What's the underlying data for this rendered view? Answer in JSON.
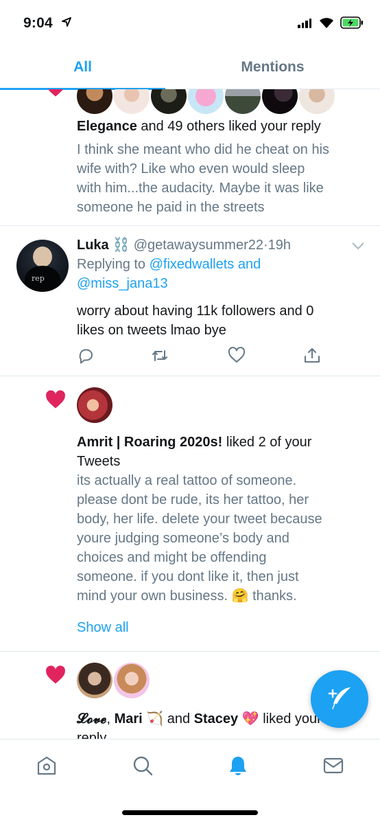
{
  "status": {
    "time": "9:04"
  },
  "tabs": [
    {
      "label": "All",
      "active": true
    },
    {
      "label": "Mentions",
      "active": false
    }
  ],
  "item1": {
    "liker": "Elegance",
    "rest": " and 49 others liked your reply",
    "text_lines": [
      "I think she meant who did he cheat on his",
      "wife with? Like who even would sleep",
      "with him...the audacity. Maybe it was like",
      "someone he paid in the streets"
    ]
  },
  "tweet": {
    "name": "Luka",
    "name_emoji": "⛓️",
    "handle": "@getawaysummer22",
    "time": "19h",
    "reply_prefix": "Replying to ",
    "reply_to_1": "@fixedwallets and",
    "reply_to_2": "@miss_jana13",
    "body_lines": [
      "worry about having 11k followers and 0",
      "likes on tweets lmao bye"
    ]
  },
  "item3": {
    "liker": "Amrit | Roaring 2020s!",
    "rest": " liked 2 of your",
    "rest2": "Tweets",
    "text_lines": [
      "its actually a real tattoo of someone.",
      "please dont be rude, its her tattoo, her",
      "body, her life. delete your tweet because",
      "youre judging someone’s body and",
      "choices and might be offending",
      "someone. if you dont like it, then just",
      "mind your own business. 🤗 thanks."
    ],
    "show_all": "Show all"
  },
  "item4": {
    "name1": "𝓛𝓸𝓿𝓮",
    "comma": ", ",
    "name2": "Mari",
    "emoji2": "🏹",
    "and": " and ",
    "name3": "Stacey",
    "emoji3": "💖",
    "rest": " liked your",
    "rest2": "reply"
  },
  "icons": {
    "heart": "heart-icon",
    "reply": "reply-icon",
    "retweet": "retweet-icon",
    "like": "like-icon",
    "share": "share-icon",
    "compose": "compose-icon",
    "home": "home-icon",
    "search": "search-icon",
    "notifications": "bell-icon",
    "messages": "mail-icon"
  },
  "colors": {
    "accent": "#1da1f2",
    "heart": "#e0245e",
    "gray_text": "#657786"
  }
}
